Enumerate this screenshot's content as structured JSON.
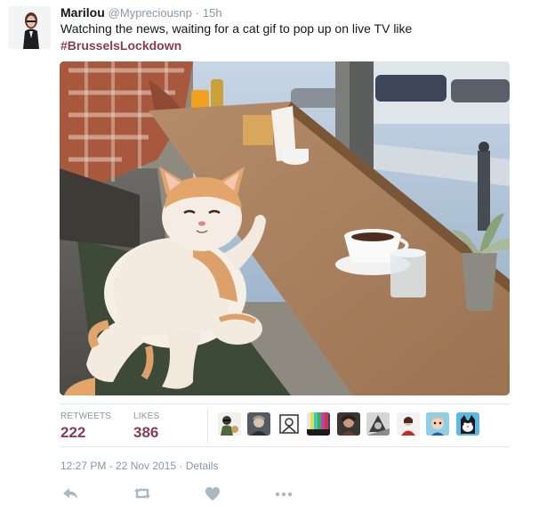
{
  "tweet": {
    "author_name": "Marilou",
    "author_handle": "@Mypreciousnp",
    "separator": "·",
    "time_ago": "15h",
    "text": "Watching the news, waiting for a cat gif to pop up on live TV like",
    "hashtag": "#BrusselsLockdown",
    "media_icon": "cat-in-cafe-gif"
  },
  "stats": {
    "retweets_label": "RETWEETS",
    "retweets_count": "222",
    "likes_label": "LIKES",
    "likes_count": "386",
    "liker_avatars": [
      "liker-avatar-1",
      "liker-avatar-2",
      "liker-avatar-3",
      "liker-avatar-4",
      "liker-avatar-5",
      "liker-avatar-6",
      "liker-avatar-7",
      "liker-avatar-8",
      "liker-avatar-9"
    ]
  },
  "meta": {
    "timestamp": "12:27 PM - 22 Nov 2015",
    "separator": "·",
    "details_label": "Details"
  },
  "actions": {
    "icons": [
      "reply-icon",
      "retweet-icon",
      "like-icon",
      "more-icon"
    ]
  },
  "colors": {
    "hashtag": "#8b3a58",
    "count": "#8b3a58",
    "muted": "#8899a6",
    "action_icon": "#aab8c2"
  }
}
